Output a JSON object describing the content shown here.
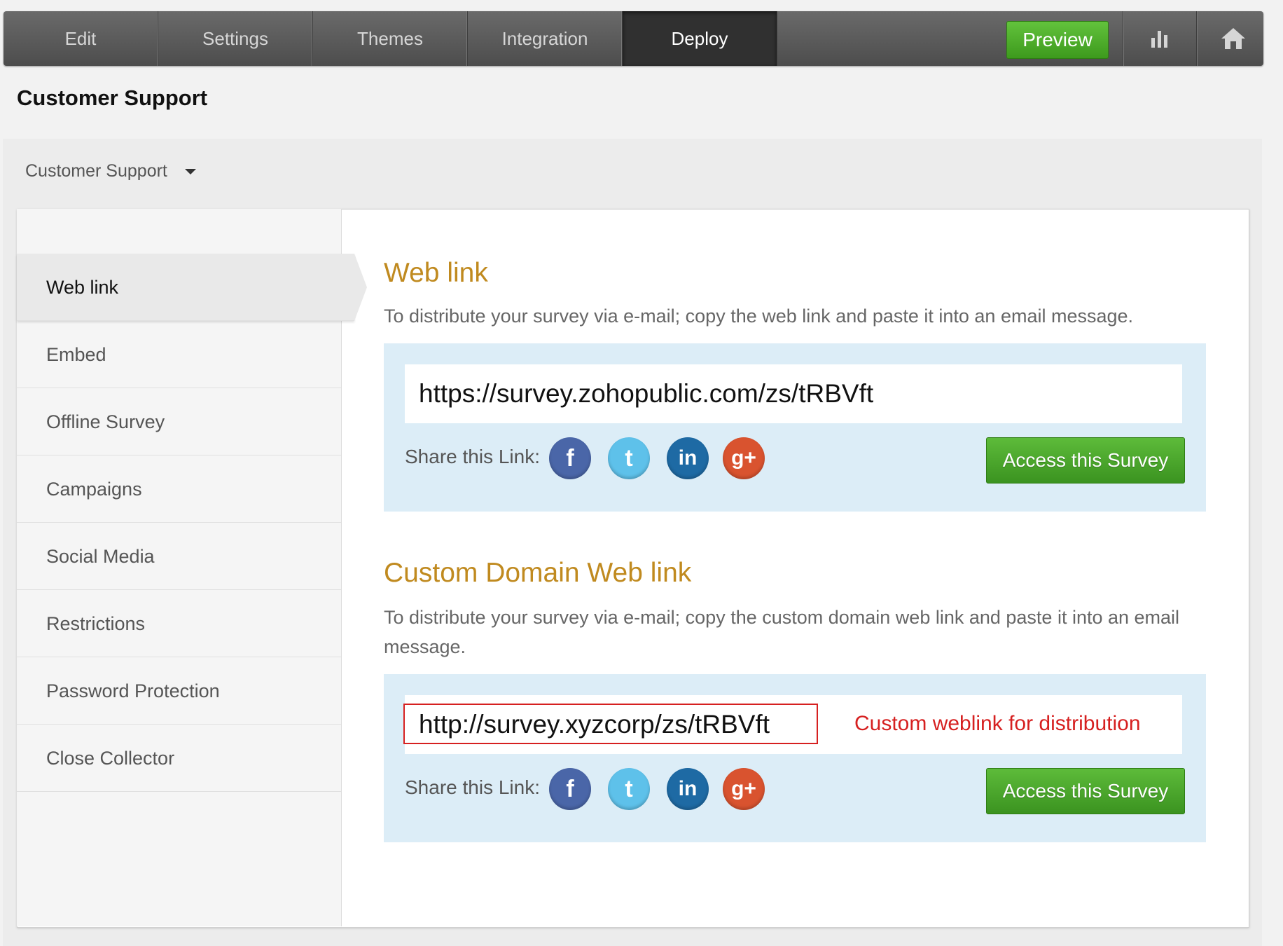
{
  "nav": {
    "tabs": [
      {
        "label": "Edit"
      },
      {
        "label": "Settings"
      },
      {
        "label": "Themes"
      },
      {
        "label": "Integration"
      },
      {
        "label": "Deploy"
      }
    ],
    "active_tab": "Deploy",
    "preview_label": "Preview",
    "icons": [
      "reports-icon",
      "home-icon"
    ]
  },
  "page_title": "Customer Support",
  "survey_select": {
    "value": "Customer Support"
  },
  "sidebar": {
    "items": [
      {
        "label": "Web link"
      },
      {
        "label": "Embed"
      },
      {
        "label": "Offline Survey"
      },
      {
        "label": "Campaigns"
      },
      {
        "label": "Social Media"
      },
      {
        "label": "Restrictions"
      },
      {
        "label": "Password Protection"
      },
      {
        "label": "Close Collector"
      }
    ],
    "active": "Web link"
  },
  "weblink": {
    "title": "Web link",
    "description": "To distribute your survey via e-mail; copy the web link and paste it into an email message.",
    "url": "https://survey.zohopublic.com/zs/tRBVft",
    "share_label": "Share this Link:",
    "access_label": "Access this Survey"
  },
  "custom": {
    "title": "Custom Domain Web link",
    "description": "To distribute your survey via e-mail; copy the custom domain web link and paste it into an email message.",
    "url": "http://survey.xyzcorp/zs/tRBVft",
    "annotation": "Custom weblink for distribution",
    "share_label": "Share this Link:",
    "access_label": "Access this Survey"
  },
  "social_icons": [
    "facebook-icon",
    "twitter-icon",
    "linkedin-icon",
    "google-plus-icon"
  ],
  "colors": {
    "accent_green": "#4cae2c",
    "section_title": "#c08a1f",
    "link_box_bg": "#dcedf7",
    "annotation_red": "#d62020",
    "facebook": "#4a66a8",
    "twitter": "#5ec1ea",
    "linkedin": "#1e6aa4",
    "google_plus": "#d9532f"
  }
}
